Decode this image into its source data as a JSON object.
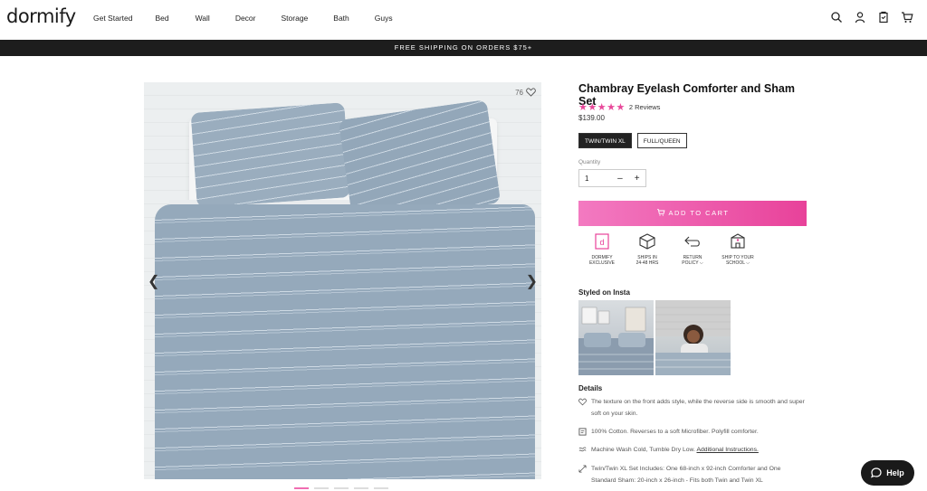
{
  "header": {
    "logo": "dormify",
    "nav": [
      "Get Started",
      "Bed",
      "Wall",
      "Decor",
      "Storage",
      "Bath",
      "Guys"
    ],
    "icons": [
      "search-icon",
      "account-icon",
      "wishlist-icon",
      "cart-icon"
    ]
  },
  "promo": "FREE SHIPPING ON ORDERS $75+",
  "gallery": {
    "favorite_count": "76",
    "dots": 5,
    "active_dot": 0
  },
  "product": {
    "title": "Chambray Eyelash Comforter and Sham Set",
    "stars": "★★★★★",
    "rating": 5,
    "reviews": "2 Reviews",
    "price": "$139.00",
    "sizes": [
      "TWIN/TWIN XL",
      "FULL/QUEEN"
    ],
    "selected_size": "TWIN/TWIN XL",
    "quantity_label": "Quantity",
    "quantity": "1",
    "qty_minus": "–",
    "qty_plus": "+",
    "add_to_cart": "ADD TO CART",
    "badges": [
      {
        "icon": "dormify-exclusive-icon",
        "l1": "DORMIFY",
        "l2": "EXCLUSIVE"
      },
      {
        "icon": "box-icon",
        "l1": "SHIPS IN",
        "l2": "24-48 HRS"
      },
      {
        "icon": "return-icon",
        "l1": "RETURN",
        "l2": "POLICY ⌵"
      },
      {
        "icon": "ship-to-school-icon",
        "l1": "SHIP TO YOUR",
        "l2": "SCHOOL ⌵"
      }
    ],
    "styled_title": "Styled on Insta",
    "details_title": "Details",
    "details": [
      {
        "icon": "heart-icon",
        "text": "The texture on the front adds style, while the reverse side is smooth and super soft on your skin."
      },
      {
        "icon": "tag-icon",
        "text": "100% Cotton. Reverses to a soft Microfiber. Polyfill comforter."
      },
      {
        "icon": "wash-icon",
        "text": "Machine Wash Cold, Tumble Dry Low.",
        "link": "Additional Instructions."
      },
      {
        "icon": "dimensions-icon",
        "text": "Twin/Twin XL Set Includes: One 68-inch x 92-inch Comforter and One Standard Sham: 20-inch x 26-inch - Fits both Twin and Twin XL"
      }
    ]
  },
  "help": "Help",
  "colors": {
    "accent": "#e8429a",
    "dark": "#1d1d1d"
  }
}
